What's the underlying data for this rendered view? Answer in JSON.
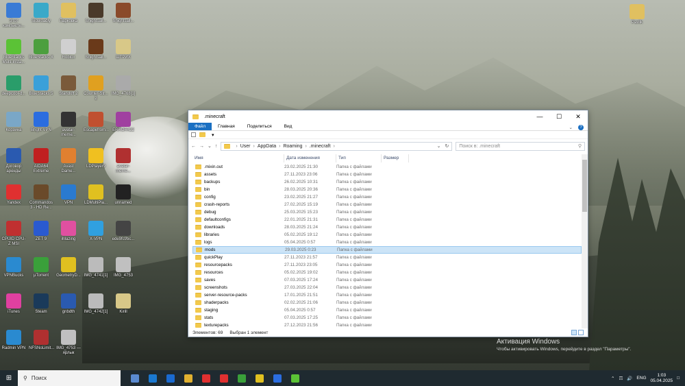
{
  "desktop": {
    "icons": [
      {
        "label": "Этот компьюте...",
        "color": "#3a7bd5"
      },
      {
        "label": "Sideloadly",
        "color": "#3aa9c9"
      },
      {
        "label": "Парковка",
        "color": "#e0c060"
      },
      {
        "label": "Snightsall...",
        "color": "#4a3a2a"
      },
      {
        "label": "Snightsall...",
        "color": "#8a4a2a"
      },
      {
        "label": "BlueStacks Multi-Insta...",
        "color": "#5bc236"
      },
      {
        "label": "BlueStacks X",
        "color": "#4c9f3e"
      },
      {
        "label": "Roblox",
        "color": "#d0d0d0"
      },
      {
        "label": "Snightsall...",
        "color": "#6a3a1a"
      },
      {
        "label": "ШТРИХ",
        "color": "#d8c888"
      },
      {
        "label": "deepcool-d...",
        "color": "#2a9d6a"
      },
      {
        "label": "BlueStacks 5",
        "color": "#3aa0d9"
      },
      {
        "label": "Standoff 2",
        "color": "#7a5a3a"
      },
      {
        "label": "Counter-Str... 2",
        "color": "#e0a020"
      },
      {
        "label": "IMG_4768[1]",
        "color": "#aaaaaa"
      },
      {
        "label": "Корзина",
        "color": "#7aa7c7"
      },
      {
        "label": "Bright VPN",
        "color": "#2b6de0"
      },
      {
        "label": "avatar-meme...",
        "color": "#333333"
      },
      {
        "label": "Escapefrom...",
        "color": "#c05030"
      },
      {
        "label": "ERROR422",
        "color": "#a040a0"
      },
      {
        "label": "Договор аренды",
        "color": "#2a5ab0"
      },
      {
        "label": "AIDA64 Extreme",
        "color": "#c02020"
      },
      {
        "label": "Avast Dame...",
        "color": "#e08030"
      },
      {
        "label": "LDPlayer9",
        "color": "#f0c020"
      },
      {
        "label": "avatar-meme...",
        "color": "#b03030"
      },
      {
        "label": "Yandex",
        "color": "#e03030"
      },
      {
        "label": "Commandos 3 - HD Re...",
        "color": "#6a4a2a"
      },
      {
        "label": "VPN",
        "color": "#2a7ad0"
      },
      {
        "label": "LDMultiPla...",
        "color": "#e0c020"
      },
      {
        "label": "unnamed",
        "color": "#222222"
      },
      {
        "label": "CPUID CPU-Z MSI",
        "color": "#c03030"
      },
      {
        "label": "ZET 9",
        "color": "#2a5ad0"
      },
      {
        "label": "iMazing",
        "color": "#e050a0"
      },
      {
        "label": "X-VPN",
        "color": "#30a0e0"
      },
      {
        "label": "ede9fcf/bc...",
        "color": "#444444"
      },
      {
        "label": "VPNBucks",
        "color": "#2a8ad0"
      },
      {
        "label": "µTorrent",
        "color": "#3aa03a"
      },
      {
        "label": "GeometryD...",
        "color": "#e0c020"
      },
      {
        "label": "IMG_4741[1]",
        "color": "#bbbbbb"
      },
      {
        "label": "IMG_4753",
        "color": "#c0c0c0"
      },
      {
        "label": "iTunes",
        "color": "#e040a0"
      },
      {
        "label": "Steam",
        "color": "#1a3a5a"
      },
      {
        "label": "gnbdth",
        "color": "#2a5ab0"
      },
      {
        "label": "IMG_4742[1]",
        "color": "#bbbbbb"
      },
      {
        "label": "Kirill",
        "color": "#d8c888"
      },
      {
        "label": "Radmin VPN",
        "color": "#2a8ad0"
      },
      {
        "label": "NFSNoLimit...",
        "color": "#b03030"
      },
      {
        "label": "IMG_4753 — ярлык",
        "color": "#c0c0c0"
      }
    ],
    "right_icon": {
      "label": "Pavlik",
      "color": "#e0c060"
    }
  },
  "explorer": {
    "title": ".minecraft",
    "ribbon_tabs": [
      "Файл",
      "Главная",
      "Поделиться",
      "Вид"
    ],
    "path": [
      "User",
      "AppData",
      "Roaming",
      ".minecraft"
    ],
    "search_placeholder": "Поиск в: .minecraft",
    "columns": [
      "Имя",
      "Дата изменения",
      "Тип",
      "Размер"
    ],
    "rows": [
      {
        "name": ".mixin.out",
        "date": "23.02.2025 21:30",
        "type": "Папка с файлами"
      },
      {
        "name": "assets",
        "date": "27.11.2023 23:06",
        "type": "Папка с файлами"
      },
      {
        "name": "backups",
        "date": "26.02.2025 10:31",
        "type": "Папка с файлами"
      },
      {
        "name": "bin",
        "date": "28.03.2025 20:36",
        "type": "Папка с файлами"
      },
      {
        "name": "config",
        "date": "23.02.2025 21:27",
        "type": "Папка с файлами"
      },
      {
        "name": "crash-reports",
        "date": "27.02.2025 15:19",
        "type": "Папка с файлами"
      },
      {
        "name": "debug",
        "date": "25.03.2025 15:23",
        "type": "Папка с файлами"
      },
      {
        "name": "defaultconfigs",
        "date": "22.01.2025 21:31",
        "type": "Папка с файлами"
      },
      {
        "name": "downloads",
        "date": "28.03.2025 21:24",
        "type": "Папка с файлами"
      },
      {
        "name": "libraries",
        "date": "05.02.2025 19:12",
        "type": "Папка с файлами"
      },
      {
        "name": "logs",
        "date": "05.04.2025 0:57",
        "type": "Папка с файлами"
      },
      {
        "name": "mods",
        "date": "29.03.2025 0:23",
        "type": "Папка с файлами",
        "selected": true
      },
      {
        "name": "quickPlay",
        "date": "27.11.2023 21:57",
        "type": "Папка с файлами"
      },
      {
        "name": "resourcepacks",
        "date": "27.11.2023 23:05",
        "type": "Папка с файлами"
      },
      {
        "name": "resources",
        "date": "05.02.2025 19:02",
        "type": "Папка с файлами"
      },
      {
        "name": "saves",
        "date": "07.03.2025 17:24",
        "type": "Папка с файлами"
      },
      {
        "name": "screenshots",
        "date": "27.03.2025 22:04",
        "type": "Папка с файлами"
      },
      {
        "name": "server-resource-packs",
        "date": "17.01.2025 21:51",
        "type": "Папка с файлами"
      },
      {
        "name": "shaderpacks",
        "date": "02.02.2025 21:06",
        "type": "Папка с файлами"
      },
      {
        "name": "staging",
        "date": "05.04.2025 0:57",
        "type": "Папка с файлами"
      },
      {
        "name": "stats",
        "date": "07.03.2025 17:25",
        "type": "Папка с файлами"
      },
      {
        "name": "texturepacks",
        "date": "27.12.2023 21:56",
        "type": "Папка с файлами"
      }
    ],
    "status_count": "Элементов: 69",
    "status_selected": "Выбран 1 элемент"
  },
  "activation": {
    "title": "Активация Windows",
    "text": "Чтобы активировать Windows, перейдите в раздел \"Параметры\"."
  },
  "taskbar": {
    "search_label": "Поиск",
    "apps": [
      "#5a8ad0",
      "#1a78d0",
      "#1a6ad0",
      "#e0b030",
      "#e03030",
      "#e03030",
      "#3aa03a",
      "#e0c020",
      "#2b6de0",
      "#5bc236"
    ],
    "lang": "ENG",
    "time": "1:03",
    "date": "05.04.2025"
  }
}
